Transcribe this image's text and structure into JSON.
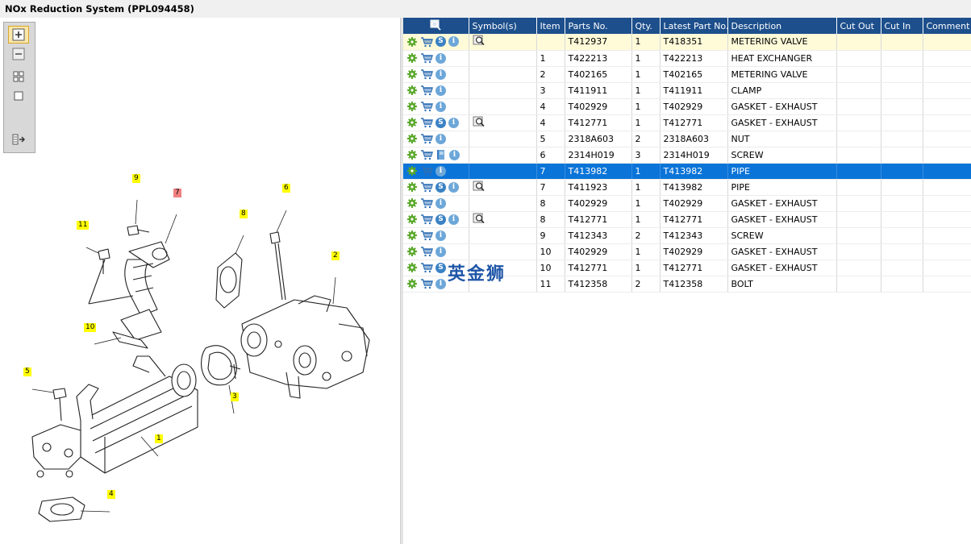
{
  "window": {
    "title": "NOx Reduction System (PPL094458)"
  },
  "toolbar": {
    "buttons": [
      {
        "name": "zoom-in-icon",
        "active": true
      },
      {
        "name": "zoom-out-icon",
        "active": false
      },
      {
        "name": "fit-all-icon",
        "active": false
      },
      {
        "name": "fit-window-icon",
        "active": false
      },
      {
        "name": "export-icon",
        "active": false
      }
    ]
  },
  "diagram": {
    "callouts": [
      {
        "label": "9",
        "color": "yellow"
      },
      {
        "label": "7",
        "color": "red"
      },
      {
        "label": "6",
        "color": "yellow"
      },
      {
        "label": "8",
        "color": "yellow"
      },
      {
        "label": "11",
        "color": "yellow"
      },
      {
        "label": "2",
        "color": "yellow"
      },
      {
        "label": "10",
        "color": "yellow"
      },
      {
        "label": "5",
        "color": "yellow"
      },
      {
        "label": "3",
        "color": "yellow"
      },
      {
        "label": "1",
        "color": "yellow"
      },
      {
        "label": "4",
        "color": "yellow"
      }
    ]
  },
  "table": {
    "columns": [
      "",
      "Symbol(s)",
      "Item",
      "Parts No.",
      "Qty.",
      "Latest Part No.",
      "Description",
      "Cut Out",
      "Cut In",
      "Comment"
    ],
    "rows": [
      {
        "icons": [
          "gear",
          "cart",
          "s",
          "i"
        ],
        "symbol": "magnifier",
        "item": "",
        "part": "T412937",
        "qty": "1",
        "latest": "T418351",
        "desc": "METERING VALVE",
        "state": "highlight"
      },
      {
        "icons": [
          "gear",
          "cart",
          "i"
        ],
        "symbol": "",
        "item": "1",
        "part": "T422213",
        "qty": "1",
        "latest": "T422213",
        "desc": "HEAT EXCHANGER",
        "state": ""
      },
      {
        "icons": [
          "gear",
          "cart",
          "i"
        ],
        "symbol": "",
        "item": "2",
        "part": "T402165",
        "qty": "1",
        "latest": "T402165",
        "desc": "METERING VALVE",
        "state": ""
      },
      {
        "icons": [
          "gear",
          "cart",
          "i"
        ],
        "symbol": "",
        "item": "3",
        "part": "T411911",
        "qty": "1",
        "latest": "T411911",
        "desc": "CLAMP",
        "state": ""
      },
      {
        "icons": [
          "gear",
          "cart",
          "i"
        ],
        "symbol": "",
        "item": "4",
        "part": "T402929",
        "qty": "1",
        "latest": "T402929",
        "desc": "GASKET - EXHAUST",
        "state": ""
      },
      {
        "icons": [
          "gear",
          "cart",
          "s",
          "i"
        ],
        "symbol": "magnifier",
        "item": "4",
        "part": "T412771",
        "qty": "1",
        "latest": "T412771",
        "desc": "GASKET - EXHAUST",
        "state": ""
      },
      {
        "icons": [
          "gear",
          "cart",
          "i"
        ],
        "symbol": "",
        "item": "5",
        "part": "2318A603",
        "qty": "2",
        "latest": "2318A603",
        "desc": "NUT",
        "state": ""
      },
      {
        "icons": [
          "gear",
          "cart",
          "book",
          "i"
        ],
        "symbol": "",
        "item": "6",
        "part": "2314H019",
        "qty": "3",
        "latest": "2314H019",
        "desc": "SCREW",
        "state": ""
      },
      {
        "icons": [
          "gear",
          "cart",
          "i"
        ],
        "symbol": "",
        "item": "7",
        "part": "T413982",
        "qty": "1",
        "latest": "T413982",
        "desc": "PIPE",
        "state": "selected"
      },
      {
        "icons": [
          "gear",
          "cart",
          "s",
          "i"
        ],
        "symbol": "magnifier",
        "item": "7",
        "part": "T411923",
        "qty": "1",
        "latest": "T413982",
        "desc": "PIPE",
        "state": ""
      },
      {
        "icons": [
          "gear",
          "cart",
          "i"
        ],
        "symbol": "",
        "item": "8",
        "part": "T402929",
        "qty": "1",
        "latest": "T402929",
        "desc": "GASKET - EXHAUST",
        "state": ""
      },
      {
        "icons": [
          "gear",
          "cart",
          "s",
          "i"
        ],
        "symbol": "magnifier",
        "item": "8",
        "part": "T412771",
        "qty": "1",
        "latest": "T412771",
        "desc": "GASKET - EXHAUST",
        "state": ""
      },
      {
        "icons": [
          "gear",
          "cart",
          "i"
        ],
        "symbol": "",
        "item": "9",
        "part": "T412343",
        "qty": "2",
        "latest": "T412343",
        "desc": "SCREW",
        "state": ""
      },
      {
        "icons": [
          "gear",
          "cart",
          "i"
        ],
        "symbol": "",
        "item": "10",
        "part": "T402929",
        "qty": "1",
        "latest": "T402929",
        "desc": "GASKET - EXHAUST",
        "state": ""
      },
      {
        "icons": [
          "gear",
          "cart",
          "s"
        ],
        "symbol": "",
        "item": "10",
        "part": "T412771",
        "qty": "1",
        "latest": "T412771",
        "desc": "GASKET - EXHAUST",
        "state": ""
      },
      {
        "icons": [
          "gear",
          "cart",
          "i"
        ],
        "symbol": "",
        "item": "11",
        "part": "T412358",
        "qty": "2",
        "latest": "T412358",
        "desc": "BOLT",
        "state": ""
      }
    ]
  },
  "watermark": {
    "text": "英金狮"
  },
  "colors": {
    "header": "#1d4f8c",
    "selected": "#0a74d8",
    "highlight": "#fffbd9",
    "callout": "#ffff00",
    "callout_red": "#f08080"
  }
}
